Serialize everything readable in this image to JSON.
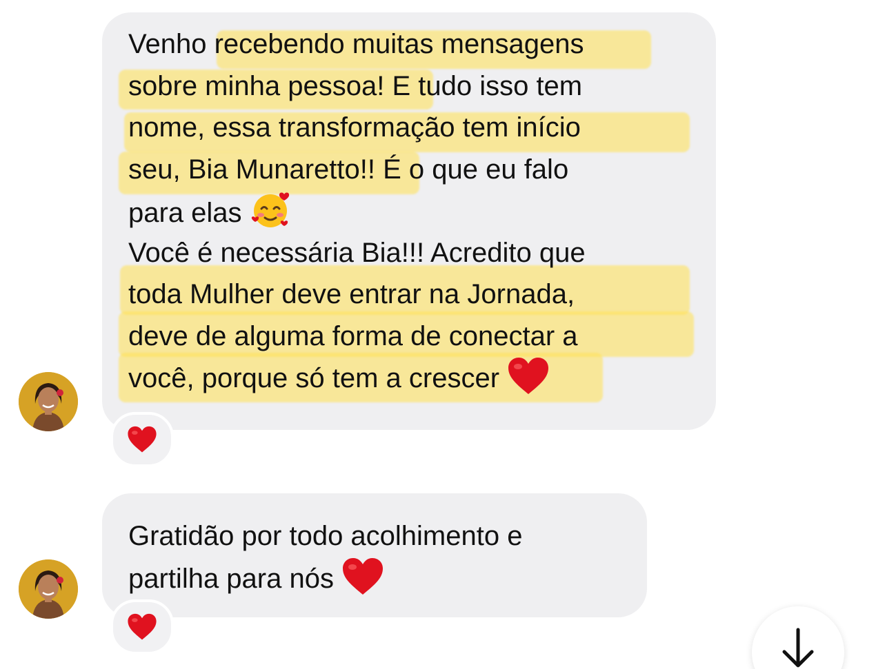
{
  "messages": [
    {
      "lines": [
        "Venho recebendo muitas mensagens",
        "sobre minha pessoa! E tudo isso tem",
        "nome, essa transformação tem início",
        "seu, Bia Munaretto!! É o que eu falo",
        "para elas",
        "Você é necessária Bia!!! Acredito que",
        "toda Mulher deve entrar na Jornada,",
        "deve de alguma forma de conectar a",
        "você, porque só tem a crescer"
      ],
      "inline_emojis": [
        "smiling-face-with-hearts",
        "red-heart"
      ],
      "reaction": "red-heart"
    },
    {
      "lines": [
        "Gratidão por todo acolhimento e",
        "partilha para nós"
      ],
      "inline_emojis": [
        "red-heart"
      ],
      "reaction": "red-heart"
    }
  ],
  "icons": {
    "scroll_down": "arrow-down-icon",
    "reaction": "red-heart-icon"
  },
  "colors": {
    "bubble": "#efeff1",
    "highlight": "#ffe25a",
    "heart": "#e0121f",
    "text": "#111111"
  }
}
